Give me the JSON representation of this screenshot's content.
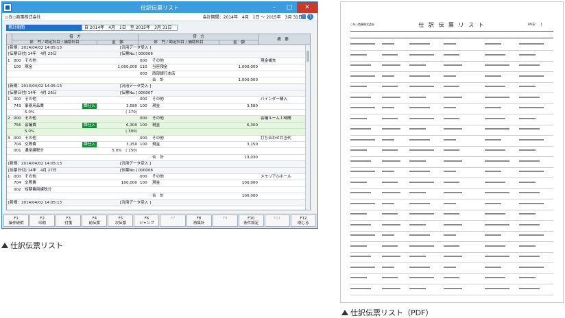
{
  "window": {
    "title": "仕訳伝票リスト",
    "company": "○Ｂ○商事株式会社",
    "period": "会計期間：2014年　4月　1日 ～ 2015年　3月 31日",
    "help": "?"
  },
  "filter": {
    "label": "累計期間",
    "value": "自 2014年　4月　1日　至 2015年　3月 31日"
  },
  "header": {
    "debit": "借　方",
    "credit": "貸　方",
    "memo": "摘　要",
    "dept": "部　門 / 勘定科目 / 補助科目",
    "amount": "金　額"
  },
  "rows": [
    {
      "cells": [
        "[新規：2014/04/02 14:05:13",
        "[汎用データ受入 ]"
      ],
      "type": "info"
    },
    {
      "cells": [
        "[伝票日付] 14年　4月 25日",
        "[伝票No.] 000006"
      ],
      "type": "info"
    },
    {
      "cells": [
        "1",
        "000",
        "その他",
        "",
        "000",
        "その他",
        "",
        "現金補充"
      ]
    },
    {
      "cells": [
        "",
        "100",
        "現金",
        "1,000,000",
        "110",
        "当座預金",
        "1,000,000",
        ""
      ]
    },
    {
      "cells": [
        "",
        "",
        "",
        "",
        "003",
        "西部銀行本店",
        "",
        ""
      ]
    },
    {
      "cells": [
        "",
        "",
        "",
        "",
        "",
        "合　計",
        "1,000,000",
        ""
      ]
    },
    {
      "cells": [
        "[新規：2014/04/02 14:05:13",
        "[汎用データ受入 ]"
      ],
      "type": "info"
    },
    {
      "cells": [
        "[伝票日付] 14年　4月 26日",
        "[伝票No.] 000007"
      ],
      "type": "info"
    },
    {
      "cells": [
        "1",
        "000",
        "その他",
        "",
        "000",
        "その他",
        "",
        "バインダー購入"
      ]
    },
    {
      "cells": [
        "",
        "743",
        "事務用品費",
        "3,580",
        "100",
        "現金",
        "3,580",
        ""
      ],
      "tag": "課仕入"
    },
    {
      "cells": [
        "",
        "",
        "5.0%",
        "( 170)",
        "",
        "",
        "",
        ""
      ]
    },
    {
      "cells": [
        "2",
        "000",
        "その他",
        "",
        "000",
        "その他",
        "",
        "会議ルーム１時間"
      ],
      "sel": true
    },
    {
      "cells": [
        "",
        "756",
        "会議費",
        "6,300",
        "100",
        "現金",
        "6,300",
        ""
      ],
      "tag": "課仕入",
      "sel": true
    },
    {
      "cells": [
        "",
        "",
        "5.0%",
        "( 300)",
        "",
        "",
        "",
        ""
      ],
      "sel": true
    },
    {
      "cells": [
        "3",
        "000",
        "その他",
        "",
        "000",
        "その他",
        "",
        "打ち合わせ弁当代"
      ]
    },
    {
      "cells": [
        "",
        "704",
        "交際費",
        "3,150",
        "100",
        "現金",
        "3,150",
        ""
      ],
      "tag": "課仕入"
    },
    {
      "cells": [
        "",
        "001",
        "通常課税分",
        "5.0%　( 150)",
        "",
        "",
        "",
        ""
      ]
    },
    {
      "cells": [
        "",
        "",
        "",
        "",
        "",
        "合　計",
        "13,030",
        ""
      ]
    },
    {
      "cells": [
        "[新規：2014/04/02 14:05:13",
        "[汎用データ受入 ]"
      ],
      "type": "info"
    },
    {
      "cells": [
        "[伝票日付] 14年　4月 27日",
        "[伝票No.] 000008"
      ],
      "type": "info"
    },
    {
      "cells": [
        "1",
        "000",
        "その他",
        "",
        "000",
        "その他",
        "",
        "メモリアルホール"
      ]
    },
    {
      "cells": [
        "",
        "704",
        "交際費",
        "100,000",
        "100",
        "現金",
        "100,000",
        ""
      ]
    },
    {
      "cells": [
        "",
        "002",
        "短期費用課税分",
        "",
        "",
        "",
        "",
        ""
      ]
    },
    {
      "cells": [
        "",
        "",
        "",
        "",
        "",
        "合　計",
        "100,000",
        ""
      ]
    },
    {
      "cells": [
        "[新規：2014/04/02 14:05:13",
        "[汎用データ受入 ]"
      ],
      "type": "info"
    }
  ],
  "fkeys": [
    [
      "F1",
      "操作説明"
    ],
    [
      "F2",
      "印刷"
    ],
    [
      "F3",
      "付箋"
    ],
    [
      "F4",
      "前伝票"
    ],
    [
      "F5",
      "次伝票"
    ],
    [
      "F6",
      "ジャンプ"
    ],
    [
      "F7",
      ""
    ],
    [
      "F8",
      "再集計"
    ],
    [
      "F9",
      ""
    ],
    [
      "F10",
      "条件設定"
    ],
    [
      "F11",
      ""
    ],
    [
      "F12",
      "閉じる"
    ]
  ],
  "captions": {
    "left": "仕訳伝票リスト",
    "right": "仕訳伝票リスト（PDF）"
  },
  "pdf": {
    "title": "仕 訳 伝 票 リ ス ト",
    "company": "○Ｂ○商事株式会社",
    "page": "PAGE：　1"
  }
}
